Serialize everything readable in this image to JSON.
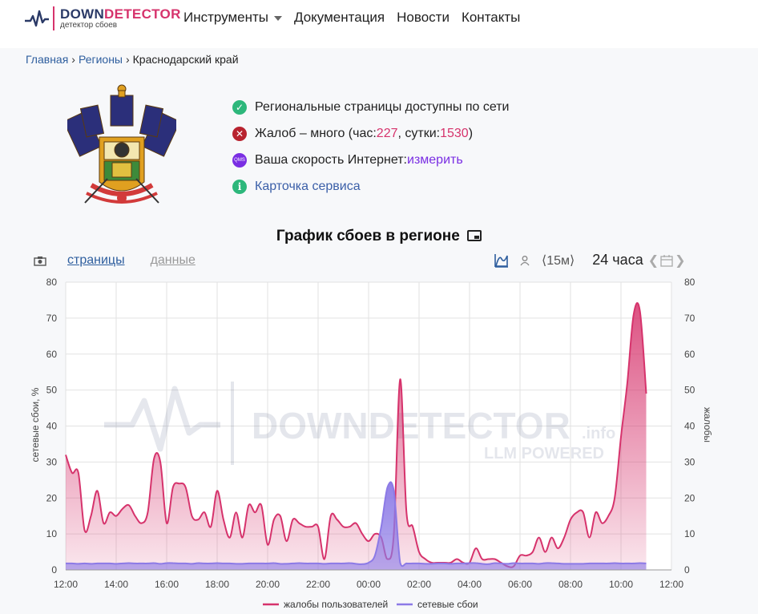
{
  "header": {
    "logo_title_a": "DOWN",
    "logo_title_b": "DETECTO",
    "logo_title_c": "R",
    "logo_subtitle": "детектор сбоев",
    "nav": [
      "Инструменты",
      "Документация",
      "Новости",
      "Контакты"
    ]
  },
  "breadcrumb": {
    "home": "Главная",
    "regions": "Регионы",
    "current": "Краснодарский край"
  },
  "status": {
    "row1": "Региональные страницы доступны по сети",
    "row2_prefix": "Жалоб – много (час: ",
    "row2_hour": "227",
    "row2_mid": ", сутки: ",
    "row2_day": "1530",
    "row2_suffix": ")",
    "row3_prefix": "Ваша скорость Интернет: ",
    "row3_link": "измерить",
    "qms_label": "QMS",
    "row4_link": "Карточка сервиса"
  },
  "chart_header": {
    "title": "График сбоев в регионе",
    "tab_pages": "страницы",
    "tab_data": "данные",
    "interval": "⟨15м⟩",
    "range": "24 часа"
  },
  "colors": {
    "complaints": "#d6336c",
    "network": "#8c7ae6",
    "accent": "#2b3a67"
  },
  "watermark": {
    "main": "DOWNDETECTOR",
    "suffix": ".info",
    "sub": "LLM POWERED"
  },
  "chart_data": {
    "type": "area",
    "ylabel_left": "сетевые сбои, %",
    "ylabel_right": "жалобы",
    "ylim": [
      0,
      80
    ],
    "yticks": [
      0,
      10,
      20,
      30,
      40,
      50,
      60,
      70,
      80
    ],
    "xticks": [
      "12:00",
      "14:00",
      "16:00",
      "18:00",
      "20:00",
      "22:00",
      "00:00",
      "02:00",
      "04:00",
      "06:00",
      "08:00",
      "10:00",
      "12:00"
    ],
    "x_hours": [
      0,
      0.25,
      0.5,
      0.75,
      1,
      1.25,
      1.5,
      1.75,
      2,
      2.25,
      2.5,
      2.75,
      3,
      3.25,
      3.5,
      3.75,
      4,
      4.25,
      4.5,
      4.75,
      5,
      5.25,
      5.5,
      5.75,
      6,
      6.25,
      6.5,
      6.75,
      7,
      7.25,
      7.5,
      7.75,
      8,
      8.25,
      8.5,
      8.75,
      9,
      9.25,
      9.5,
      9.75,
      10,
      10.25,
      10.5,
      10.75,
      11,
      11.25,
      11.5,
      11.75,
      12,
      12.25,
      12.5,
      12.75,
      13,
      13.25,
      13.5,
      13.75,
      14,
      14.25,
      14.5,
      14.75,
      15,
      15.25,
      15.5,
      15.75,
      16,
      16.25,
      16.5,
      16.75,
      17,
      17.25,
      17.5,
      17.75,
      18,
      18.25,
      18.5,
      18.75,
      19,
      19.25,
      19.5,
      19.75,
      20,
      20.25,
      20.5,
      20.75,
      21,
      21.25,
      21.5,
      21.75,
      22,
      22.25,
      22.5,
      22.75,
      23,
      23.25,
      23.5,
      23.75,
      24
    ],
    "legend": [
      "жалобы пользователей",
      "сетевые сбои"
    ],
    "legend_position": "bottom",
    "series": [
      {
        "name": "жалобы пользователей",
        "values": [
          32,
          27,
          27,
          11,
          15,
          22,
          13,
          16,
          15,
          17,
          18,
          15,
          13,
          16,
          31,
          30,
          13,
          23,
          24,
          23,
          15,
          14,
          16,
          12,
          22,
          14,
          9,
          16,
          9,
          18,
          16,
          18,
          7,
          14,
          15,
          8,
          14,
          13,
          12,
          12,
          12,
          3,
          15,
          14,
          12,
          12,
          13,
          10,
          8,
          10,
          9,
          3,
          10,
          53,
          16,
          12,
          5,
          3,
          2,
          2,
          2,
          2,
          3,
          2,
          2,
          6,
          3,
          3,
          3,
          2,
          1,
          1,
          4,
          4,
          5,
          9,
          5,
          9,
          6,
          9,
          14,
          16,
          16,
          9,
          16,
          13,
          15,
          20,
          37,
          52,
          71,
          72,
          49
        ],
        "color": "#d6336c"
      },
      {
        "name": "сетевые сбои",
        "values": [
          1.8,
          1.8,
          1.7,
          1.8,
          1.7,
          1.8,
          1.8,
          1.8,
          1.7,
          1.8,
          1.9,
          1.8,
          1.8,
          1.8,
          1.9,
          1.7,
          1.9,
          1.9,
          1.8,
          1.8,
          1.7,
          1.9,
          1.8,
          1.8,
          1.9,
          1.8,
          1.8,
          1.7,
          1.7,
          1.8,
          1.8,
          1.8,
          1.8,
          1.9,
          1.7,
          1.7,
          1.8,
          1.9,
          1.8,
          1.8,
          1.8,
          1.7,
          1.8,
          1.8,
          1.8,
          1.9,
          1.7,
          1.6,
          2,
          4,
          12,
          23,
          22,
          2,
          1.8,
          1.8,
          1.8,
          1.7,
          1.7,
          1.8,
          1.8,
          1.7,
          1.8,
          1.8,
          1.9,
          1.9,
          1.7,
          1.6,
          1.9,
          1.8,
          1.7,
          1.9,
          1.8,
          1.8,
          1.8,
          1.7,
          1.9,
          1.9,
          1.8,
          1.7,
          1.7,
          1.7,
          1.7,
          1.8,
          1.8,
          1.8,
          1.8,
          1.9,
          1.8,
          1.8,
          1.8,
          1.9,
          1.8
        ],
        "color": "#8c7ae6"
      }
    ],
    "grid": true
  }
}
